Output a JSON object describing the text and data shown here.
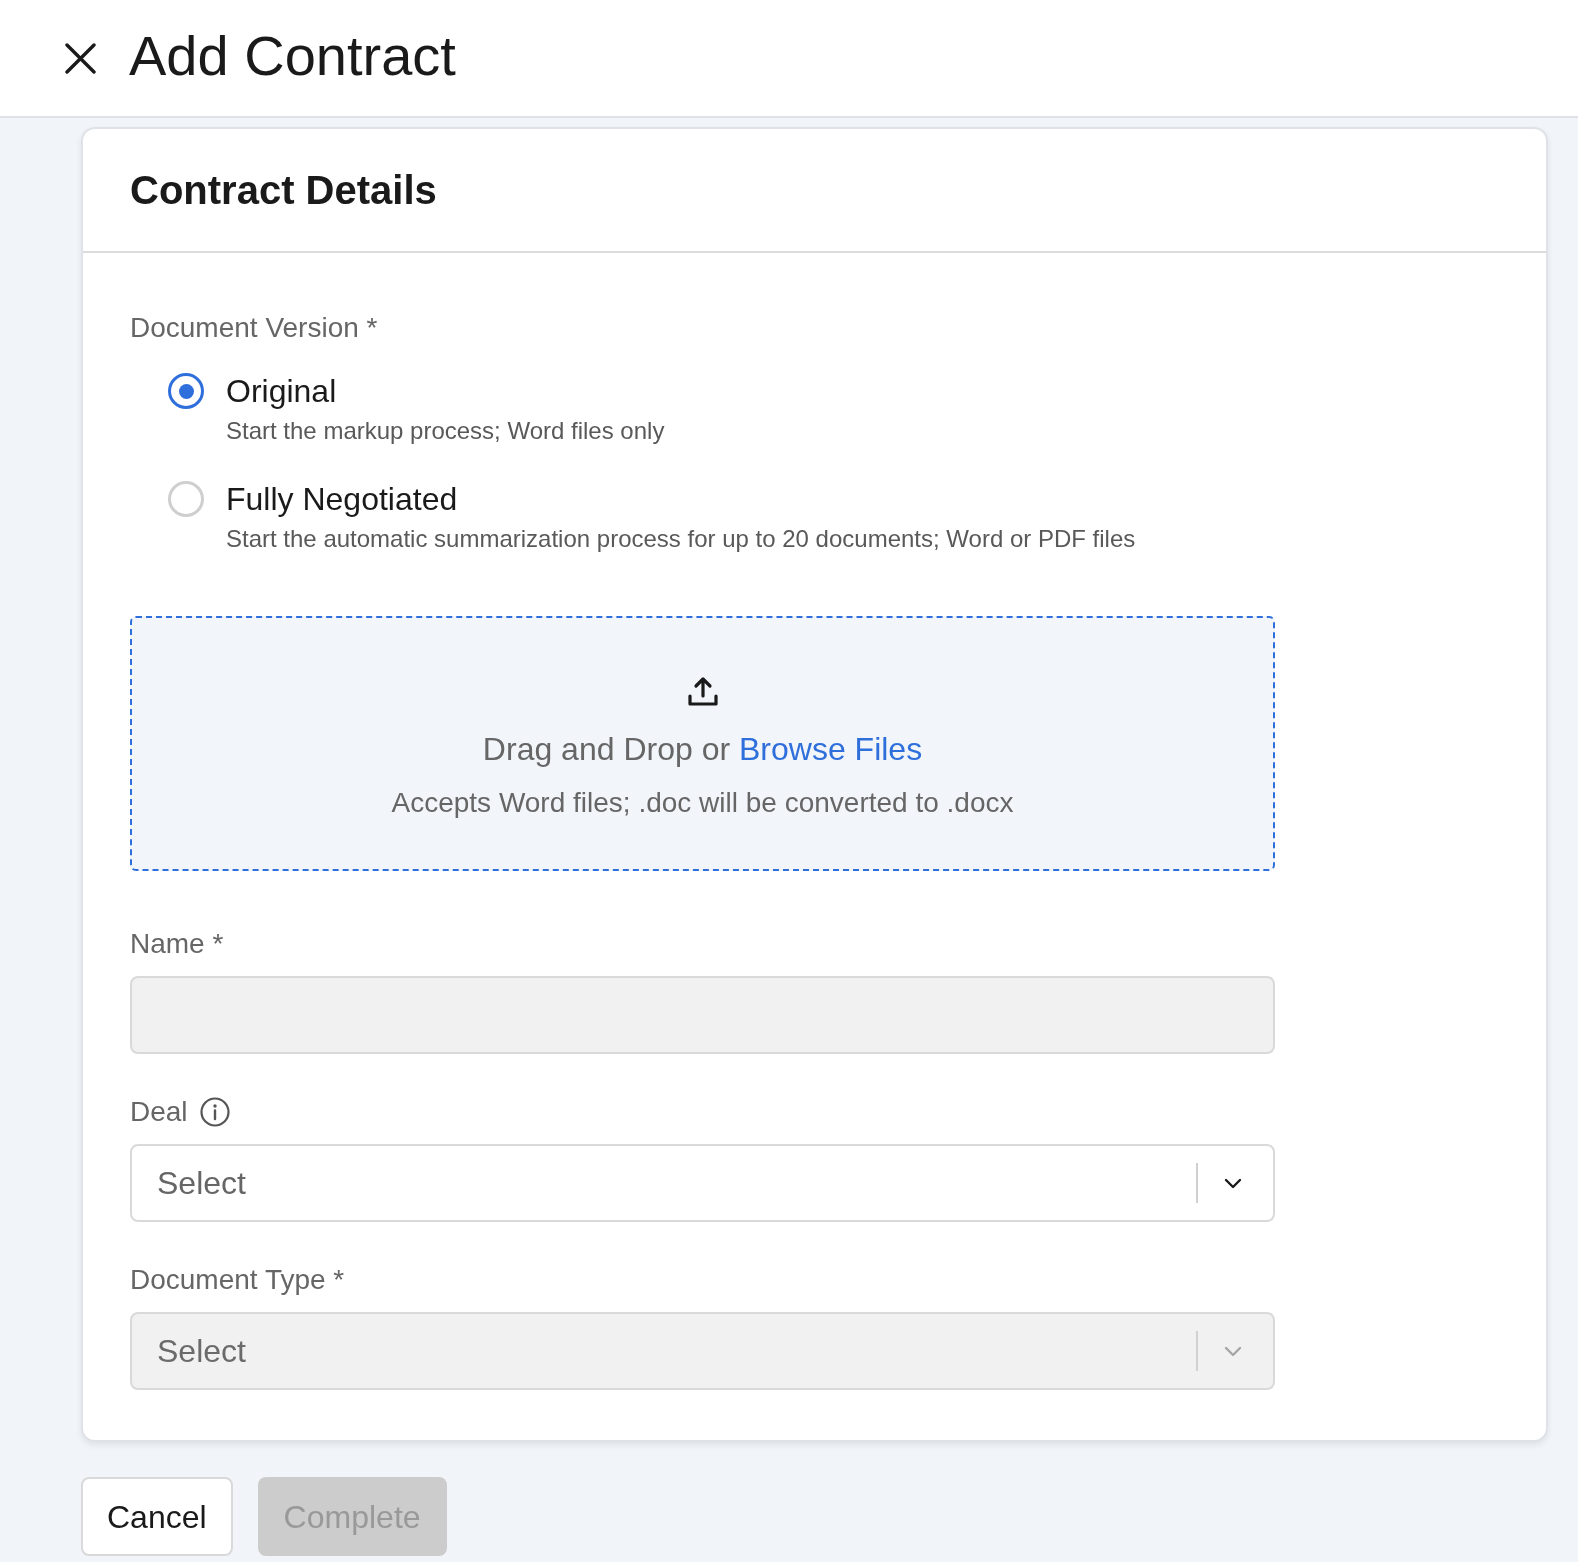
{
  "header": {
    "title": "Add Contract"
  },
  "card": {
    "title": "Contract Details"
  },
  "document_version": {
    "label": "Document Version *",
    "options": [
      {
        "label": "Original",
        "description": "Start the markup process; Word files only",
        "selected": true
      },
      {
        "label": "Fully Negotiated",
        "description": "Start the automatic summarization process for up to 20 documents; Word or PDF files",
        "selected": false
      }
    ]
  },
  "upload": {
    "prompt": "Drag and Drop or",
    "link": "Browse Files",
    "hint": "Accepts Word files; .doc will be converted to .docx"
  },
  "fields": [
    {
      "kind": "text",
      "label": "Name *",
      "disabled": true
    },
    {
      "kind": "select",
      "label": "Deal",
      "info": true,
      "placeholder": "Select",
      "disabled": false
    },
    {
      "kind": "select",
      "label": "Document Type *",
      "placeholder": "Select",
      "disabled": true
    }
  ],
  "buttons": [
    {
      "kind": "secondary",
      "label": "Cancel",
      "disabled": false
    },
    {
      "kind": "primary",
      "label": "Complete",
      "disabled": true
    }
  ]
}
